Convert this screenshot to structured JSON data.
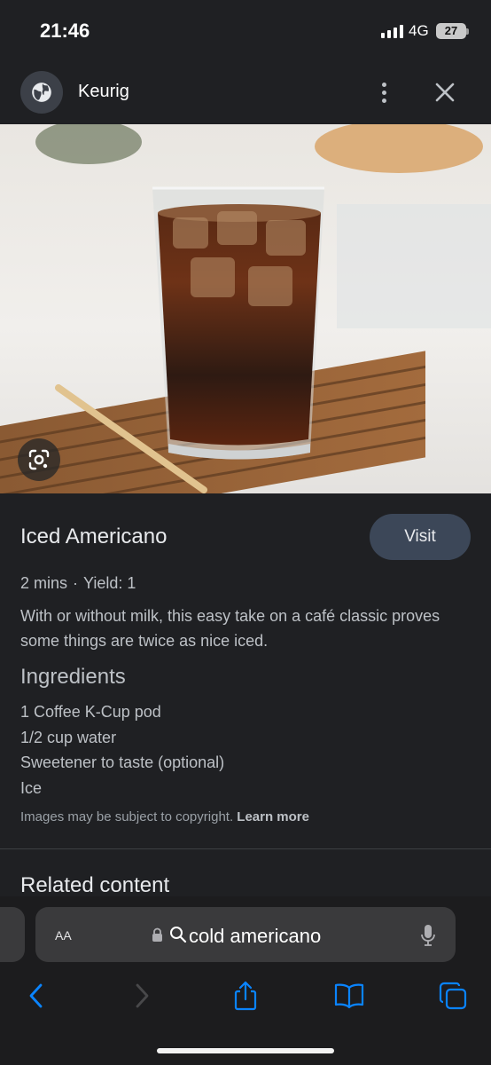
{
  "status_bar": {
    "time": "21:46",
    "network": "4G",
    "battery": "27"
  },
  "header": {
    "site_name": "Keurig",
    "icons": [
      "globe-icon",
      "more-vert-icon",
      "close-icon"
    ]
  },
  "image": {
    "description_icon": "google-lens-icon"
  },
  "recipe": {
    "title": "Iced Americano",
    "visit_label": "Visit",
    "time": "2 mins",
    "separator": "·",
    "yield": "Yield: 1",
    "description": "With or without milk, this easy take on a café classic proves some things are twice as nice iced.",
    "ingredients_heading": "Ingredients",
    "ingredients": [
      "1 Coffee K-Cup pod",
      "1/2 cup water",
      "Sweetener to taste (optional)",
      "Ice"
    ],
    "copyright_text": "Images may be subject to copyright.",
    "learn_more": "Learn more",
    "related_heading": "Related content"
  },
  "browser": {
    "text_size_label": "AA",
    "query": "cold americano",
    "toolbar_icons": [
      "back-icon",
      "forward-icon",
      "share-icon",
      "bookmarks-icon",
      "tabs-icon"
    ]
  },
  "colors": {
    "background": "#1f2023",
    "visit_button": "#3c4758",
    "accent": "#0a84ff"
  }
}
